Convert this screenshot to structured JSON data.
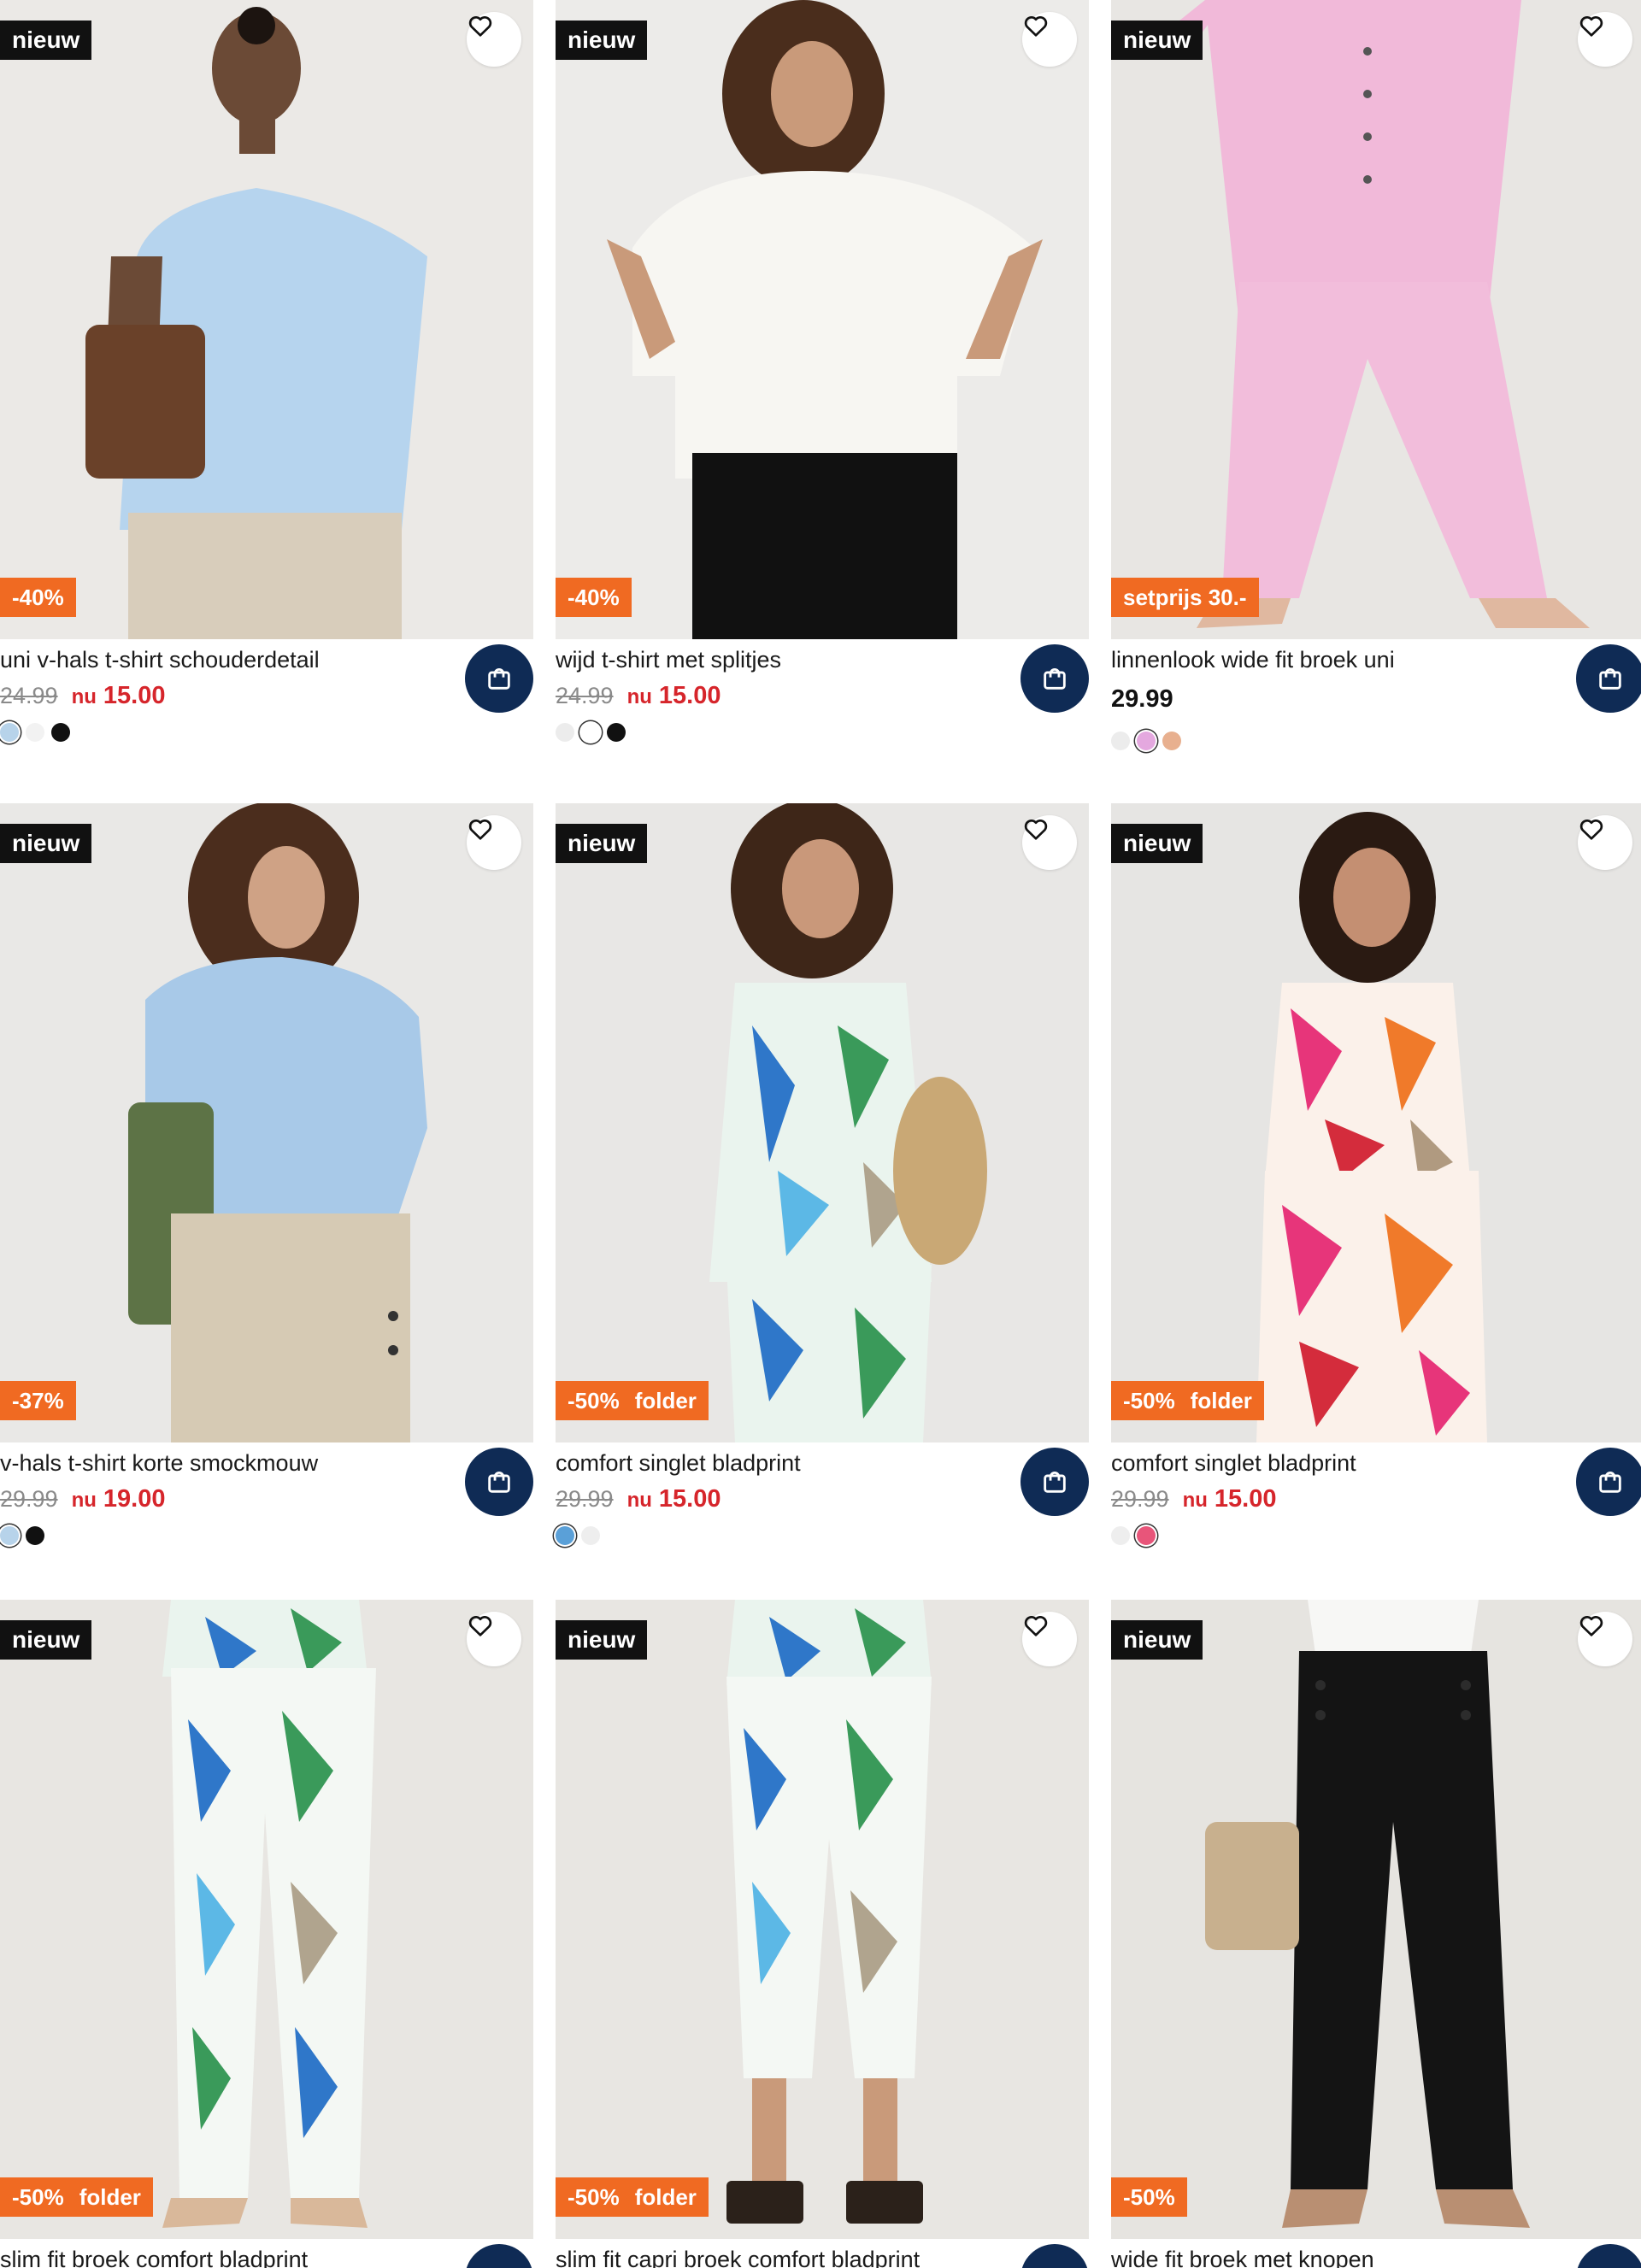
{
  "colors": {
    "new_badge_bg": "#111111",
    "promo_bg": "#f06a22",
    "sale_price": "#d6252b",
    "cart_button_bg": "#0f2b55"
  },
  "icons": {
    "wishlist": "heart-icon",
    "cart": "shopping-bag-icon"
  },
  "products": [
    {
      "badge": "nieuw",
      "promo": [
        "-40%"
      ],
      "title": "uni v-hals t-shirt schouderdetail",
      "old_price": "24.99",
      "nu": "nu",
      "price": "15.00",
      "regular_price": "",
      "swatches": [
        "#b7d3ea",
        "#f2f2f2",
        "#111111"
      ],
      "selected": 0
    },
    {
      "badge": "nieuw",
      "promo": [
        "-40%"
      ],
      "title": "wijd t-shirt met splitjes",
      "old_price": "24.99",
      "nu": "nu",
      "price": "15.00",
      "regular_price": "",
      "swatches": [
        "#ececec",
        "#ffffff",
        "#111111"
      ],
      "selected": 1
    },
    {
      "badge": "nieuw",
      "promo": [
        "setprijs 30.-"
      ],
      "title": "linnenlook wide fit broek uni",
      "old_price": "",
      "nu": "",
      "price": "",
      "regular_price": "29.99",
      "swatches": [
        "#ececec",
        "#e4a8df",
        "#e8b08f"
      ],
      "selected": 1
    },
    {
      "badge": "nieuw",
      "promo": [
        "-37%"
      ],
      "title": "v-hals t-shirt korte smockmouw",
      "old_price": "29.99",
      "nu": "nu",
      "price": "19.00",
      "regular_price": "",
      "swatches": [
        "#b7d3ea",
        "#111111"
      ],
      "selected": 0
    },
    {
      "badge": "nieuw",
      "promo": [
        "-50%",
        "folder"
      ],
      "title": "comfort singlet bladprint",
      "old_price": "29.99",
      "nu": "nu",
      "price": "15.00",
      "regular_price": "",
      "swatches": [
        "#5aa0d8",
        "#eeeeee"
      ],
      "selected": 0
    },
    {
      "badge": "nieuw",
      "promo": [
        "-50%",
        "folder"
      ],
      "title": "comfort singlet bladprint",
      "old_price": "29.99",
      "nu": "nu",
      "price": "15.00",
      "regular_price": "",
      "swatches": [
        "#eeeeee",
        "#e8557a"
      ],
      "selected": 1
    },
    {
      "badge": "nieuw",
      "promo": [
        "-50%",
        "folder"
      ],
      "title": "slim fit broek comfort bladprint",
      "old_price": "",
      "nu": "",
      "price": "",
      "regular_price": "",
      "swatches": [],
      "selected": -1
    },
    {
      "badge": "nieuw",
      "promo": [
        "-50%",
        "folder"
      ],
      "title": "slim fit capri broek comfort bladprint",
      "old_price": "",
      "nu": "",
      "price": "",
      "regular_price": "",
      "swatches": [],
      "selected": -1
    },
    {
      "badge": "nieuw",
      "promo": [
        "-50%"
      ],
      "title": "wide fit broek met knopen",
      "old_price": "",
      "nu": "",
      "price": "",
      "regular_price": "",
      "swatches": [],
      "selected": -1
    }
  ]
}
